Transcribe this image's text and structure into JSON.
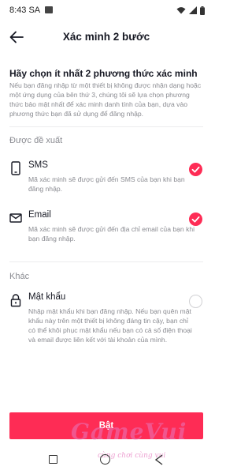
{
  "status_bar": {
    "time": "8:43 SA"
  },
  "header": {
    "title": "Xác minh 2 bước"
  },
  "headline": "Hãy chọn ít nhất 2 phương thức xác minh",
  "intro": "Nếu bạn đăng nhập từ một thiết bị không được nhận dạng hoặc một ứng dụng của bên thứ 3, chúng tôi sẽ lựa chọn phương thức bảo mật nhất để xác minh danh tính của bạn, dựa vào phương thức bạn đã sử dụng để đăng nhập.",
  "sections": {
    "recommended": "Được đề xuất",
    "other": "Khác"
  },
  "options": {
    "sms": {
      "title": "SMS",
      "desc": "Mã xác minh sẽ được gửi đến SMS của bạn khi bạn đăng nhập.",
      "selected": true
    },
    "email": {
      "title": "Email",
      "desc": "Mã xác minh sẽ được gửi đến địa chỉ email của bạn khi bạn đăng nhập.",
      "selected": true
    },
    "password": {
      "title": "Mật khẩu",
      "desc": "Nhập mật khẩu khi bạn đăng nhập. Nếu bạn quên mật khẩu này trên một thiết bị không đáng tin cậy, bạn chỉ có thể khôi phục mật khẩu nếu bạn có cả số điện thoại và email được liên kết với tài khoản của mình.",
      "selected": false
    }
  },
  "primary_button": "Bật",
  "watermark": {
    "main": "GameVui",
    "sub": "cùng chơi cùng vui"
  },
  "colors": {
    "accent": "#fe2c55",
    "text": "#161823",
    "muted": "#8a8b91"
  },
  "icons": {
    "back": "arrow-left-icon",
    "sms": "phone-icon",
    "email": "mail-icon",
    "password": "lock-icon"
  }
}
